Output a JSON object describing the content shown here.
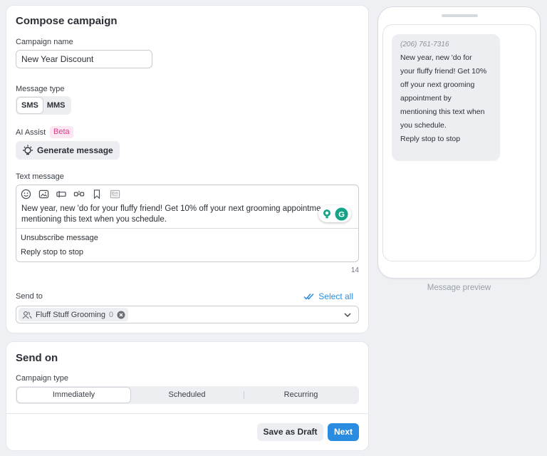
{
  "compose": {
    "title": "Compose campaign",
    "campaign_name_label": "Campaign name",
    "campaign_name_value": "New Year Discount",
    "message_type_label": "Message type",
    "message_types": [
      "SMS",
      "MMS"
    ],
    "message_type_selected": "SMS",
    "ai_assist_label": "AI Assist",
    "ai_badge": "Beta",
    "generate_label": "Generate message",
    "text_message_label": "Text message",
    "message_line1": "New year, new 'do for your fluffy friend! Get 10% off your next grooming appointment by",
    "message_line2": "mentioning this text when you schedule.",
    "unsubscribe_label": "Unsubscribe message",
    "unsubscribe_text": "Reply stop to stop",
    "char_count": "14",
    "send_to_label": "Send to",
    "select_all_label": "Select all",
    "recipient_chip_label": "Fluff Stuff Grooming",
    "recipient_chip_count": "0"
  },
  "send_on": {
    "title": "Send on",
    "campaign_type_label": "Campaign type",
    "options": [
      "Immediately",
      "Scheduled",
      "Recurring"
    ],
    "selected": "Immediately",
    "save_draft_label": "Save as Draft",
    "next_label": "Next"
  },
  "preview": {
    "phone_number": "(206) 761-7316",
    "line1": "New year, new 'do for",
    "line2": "your fluffy friend! Get 10%",
    "line3": "off your next grooming",
    "line4": "appointment by",
    "line5": "mentioning this text when",
    "line6": "you schedule.",
    "line7": "Reply stop to stop",
    "caption": "Message preview"
  },
  "colors": {
    "accent": "#2a8ce0",
    "beta_text": "#d63e8a",
    "beta_bg": "#fbe6f1",
    "grammarly": "#15a38a"
  },
  "icons": [
    "emoji-icon",
    "image-icon",
    "tag-icon",
    "link-icon",
    "bookmark-icon",
    "template-icon",
    "lightbulb-icon",
    "grammarly-icon",
    "double-check-icon",
    "group-icon",
    "remove-chip-icon",
    "chevron-down-icon"
  ]
}
